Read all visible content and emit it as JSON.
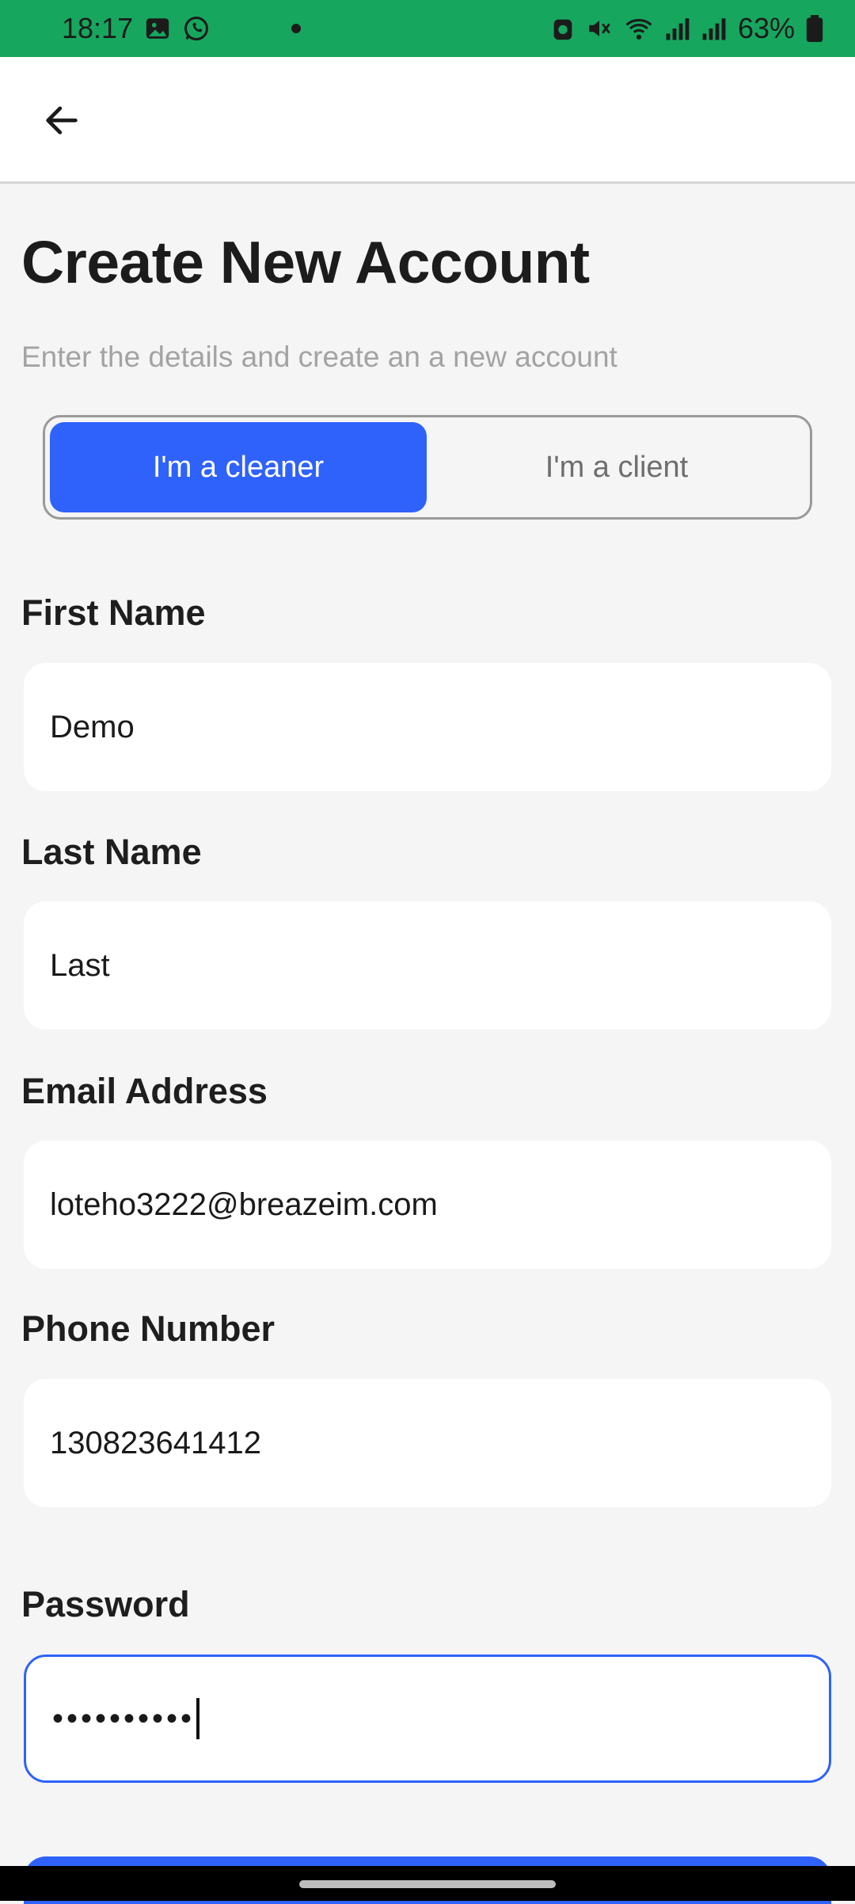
{
  "status_bar": {
    "time": "18:17",
    "battery": "63%",
    "left_icons": [
      "gallery-icon",
      "whatsapp-icon",
      "notification-dot"
    ],
    "right_icons": [
      "alarm-icon",
      "mute-icon",
      "wifi-icon",
      "signal-icon",
      "signal-icon",
      "battery-icon"
    ],
    "background_color": "#17a65e"
  },
  "app_bar": {
    "back_icon": "arrow-left-icon"
  },
  "page": {
    "title": "Create New Account",
    "subtitle": "Enter the details and create an a new account"
  },
  "account_type": {
    "options": [
      "I'm a cleaner",
      "I'm a client"
    ],
    "selected": "I'm a cleaner",
    "accent_color": "#2e62fa"
  },
  "form": {
    "first_name": {
      "label": "First Name",
      "value": "Demo"
    },
    "last_name": {
      "label": "Last Name",
      "value": "Last"
    },
    "email": {
      "label": "Email Address",
      "value": "loteho3222@breazeim.com"
    },
    "phone": {
      "label": "Phone Number",
      "value": "130823641412"
    },
    "password": {
      "label": "Password",
      "value": "••••••••••",
      "focused": true
    }
  }
}
